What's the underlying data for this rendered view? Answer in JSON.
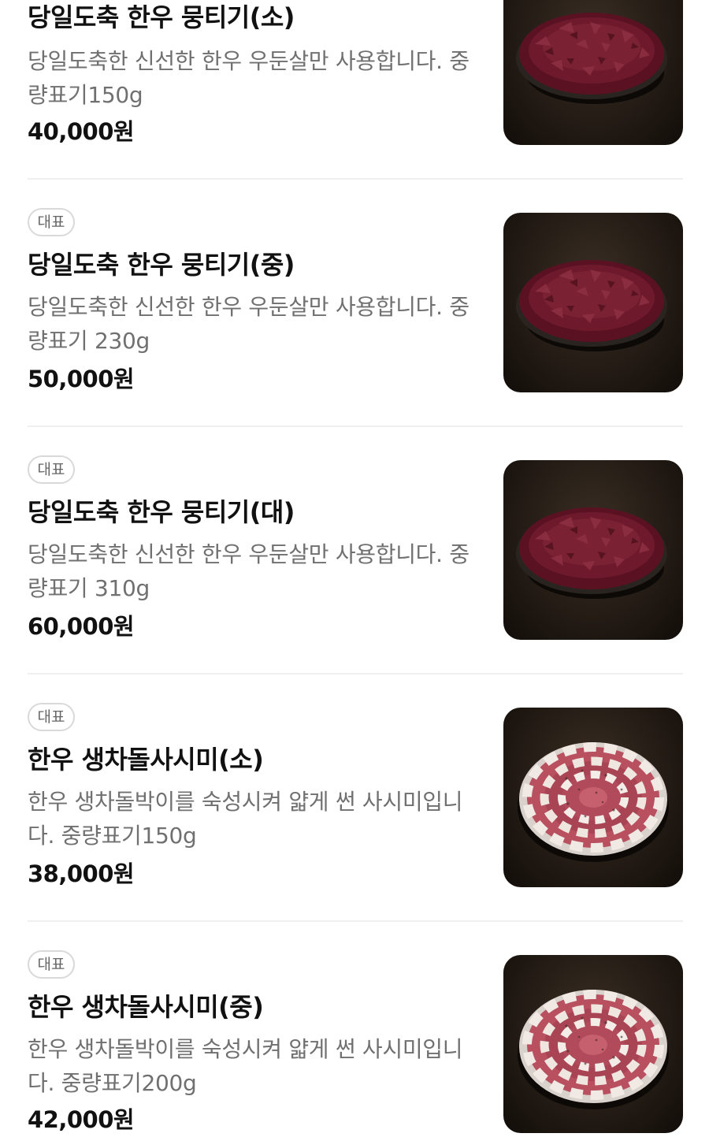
{
  "menu": {
    "items": [
      {
        "badge": "",
        "title": "당일도축 한우 뭉티기(소)",
        "description": "당일도축한 신선한 한우 우둔살만 사용합니다. 중량표기150g",
        "price": "40,000원",
        "image": "raw-beef-plate"
      },
      {
        "badge": "대표",
        "title": "당일도축 한우 뭉티기(중)",
        "description": "당일도축한 신선한 한우 우둔살만 사용합니다. 중량표기 230g",
        "price": "50,000원",
        "image": "raw-beef-plate"
      },
      {
        "badge": "대표",
        "title": "당일도축 한우 뭉티기(대)",
        "description": "당일도축한 신선한 한우 우둔살만 사용합니다. 중량표기 310g",
        "price": "60,000원",
        "image": "raw-beef-plate"
      },
      {
        "badge": "대표",
        "title": "한우 생차돌사시미(소)",
        "description": "한우 생차돌박이를 숙성시켜 얇게 썬 사시미입니다. 중량표기150g",
        "price": "38,000원",
        "image": "brisket-sashimi-plate"
      },
      {
        "badge": "대표",
        "title": "한우 생차돌사시미(중)",
        "description": "한우 생차돌박이를 숙성시켜 얇게 썬 사시미입니다. 중량표기200g",
        "price": "42,000원",
        "image": "brisket-sashimi-plate"
      }
    ]
  },
  "colors": {
    "title": "#111111",
    "description": "#707070",
    "badge_border": "#d9d9d9",
    "divider": "#efefef",
    "beef": "#6a1526",
    "photo_background": "#241c15"
  }
}
